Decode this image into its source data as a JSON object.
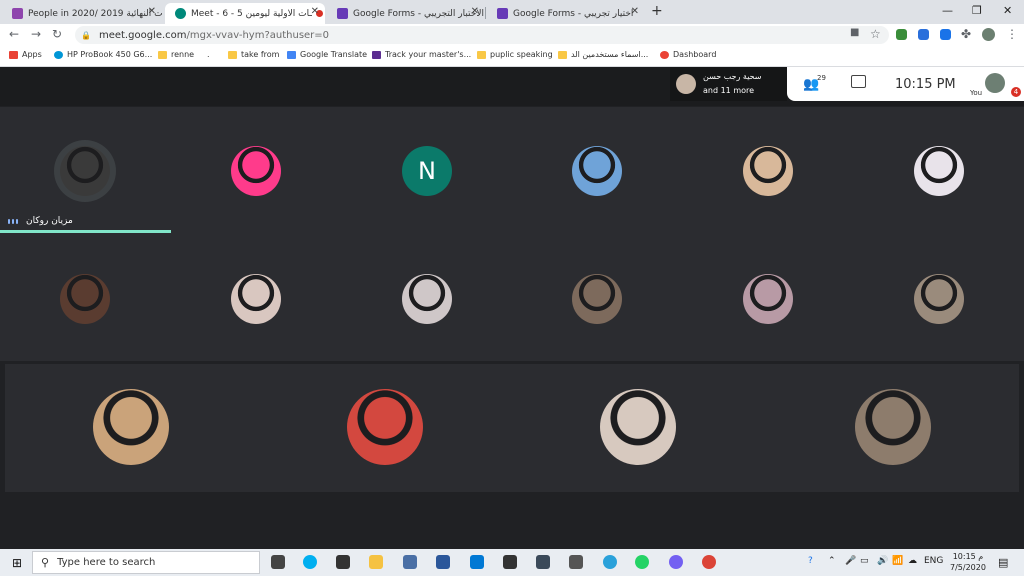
{
  "tabs": [
    {
      "title": "People in 2020/ 2019 ــات النهائية",
      "active": false,
      "color": "#8e44ad"
    },
    {
      "title": "Meet - 6 - 5 ـات الاولية ليومين",
      "active": true,
      "color": "#00897b"
    },
    {
      "title": "Google Forms - الاختبار التجريبي",
      "active": false,
      "color": "#673ab7"
    },
    {
      "title": "Google Forms - اختيار تجريبي",
      "active": false,
      "color": "#673ab7"
    }
  ],
  "address": {
    "host": "meet.google.com",
    "path": "/mgx-vvav-hym?authuser=0"
  },
  "bookmarks": [
    {
      "label": "Apps",
      "color": "#e94235"
    },
    {
      "label": "HP ProBook 450 G6...",
      "color": "#0096d6"
    },
    {
      "label": "renne",
      "color": "#f9c846"
    },
    {
      "label": ".",
      "color": "#ffffff"
    },
    {
      "label": "take from",
      "color": "#f9c846"
    },
    {
      "label": "Google Translate",
      "color": "#4285f4"
    },
    {
      "label": "Track your master's...",
      "color": "#5c2d91"
    },
    {
      "label": "puplic speaking",
      "color": "#f9c846"
    },
    {
      "label": "اسماء مستخدمين الد...",
      "color": "#f9c846"
    },
    {
      "label": "Dashboard",
      "color": "#ea4335"
    }
  ],
  "meet": {
    "presenter_line1": "سحية رجب حسن",
    "presenter_line2": "and 11 more",
    "people_count": "29",
    "time": "10:15 PM",
    "self_label": "You",
    "self_badge": "4",
    "speaker_name": "مزيان روكان",
    "tiles_row1": [
      {
        "kind": "photo",
        "color": "#3a3a3a"
      },
      {
        "kind": "photo",
        "color": "#ff3b8b"
      },
      {
        "kind": "letter",
        "letter": "N",
        "color": "#0b7a6a"
      },
      {
        "kind": "photo",
        "color": "#6fa3d8"
      },
      {
        "kind": "photo",
        "color": "#d8b89a"
      },
      {
        "kind": "photo",
        "color": "#e8e3ea"
      }
    ],
    "tiles_row2": [
      {
        "kind": "photo",
        "color": "#5a3c30"
      },
      {
        "kind": "photo",
        "color": "#d9c7c0"
      },
      {
        "kind": "photo",
        "color": "#cfc7c8"
      },
      {
        "kind": "photo",
        "color": "#7d6a5c"
      },
      {
        "kind": "photo",
        "color": "#b89aa5"
      },
      {
        "kind": "photo",
        "color": "#9a8b7c"
      }
    ],
    "tiles_row3": [
      {
        "kind": "photo",
        "color": "#caa37a"
      },
      {
        "kind": "photo",
        "color": "#d3483f"
      },
      {
        "kind": "photo",
        "color": "#d7c9bf"
      },
      {
        "kind": "photo",
        "color": "#8d7c6c"
      }
    ]
  },
  "taskbar": {
    "search_placeholder": "Type here to search",
    "lang": "ENG",
    "time": "10:15 م",
    "date": "7/5/2020",
    "apps": [
      {
        "name": "task-view",
        "color": "#444"
      },
      {
        "name": "skype",
        "color": "#00aff0"
      },
      {
        "name": "store",
        "color": "#333"
      },
      {
        "name": "file-explorer",
        "color": "#f5c242"
      },
      {
        "name": "network",
        "color": "#4a6fa5"
      },
      {
        "name": "word",
        "color": "#2b579a"
      },
      {
        "name": "mail",
        "color": "#0078d4"
      },
      {
        "name": "sticky",
        "color": "#333"
      },
      {
        "name": "calculator",
        "color": "#3b4a5a"
      },
      {
        "name": "camera",
        "color": "#555"
      },
      {
        "name": "telegram",
        "color": "#2aa1da"
      },
      {
        "name": "whatsapp",
        "color": "#25d366"
      },
      {
        "name": "viber",
        "color": "#7360f2"
      },
      {
        "name": "chrome",
        "color": "#db4437"
      }
    ]
  }
}
